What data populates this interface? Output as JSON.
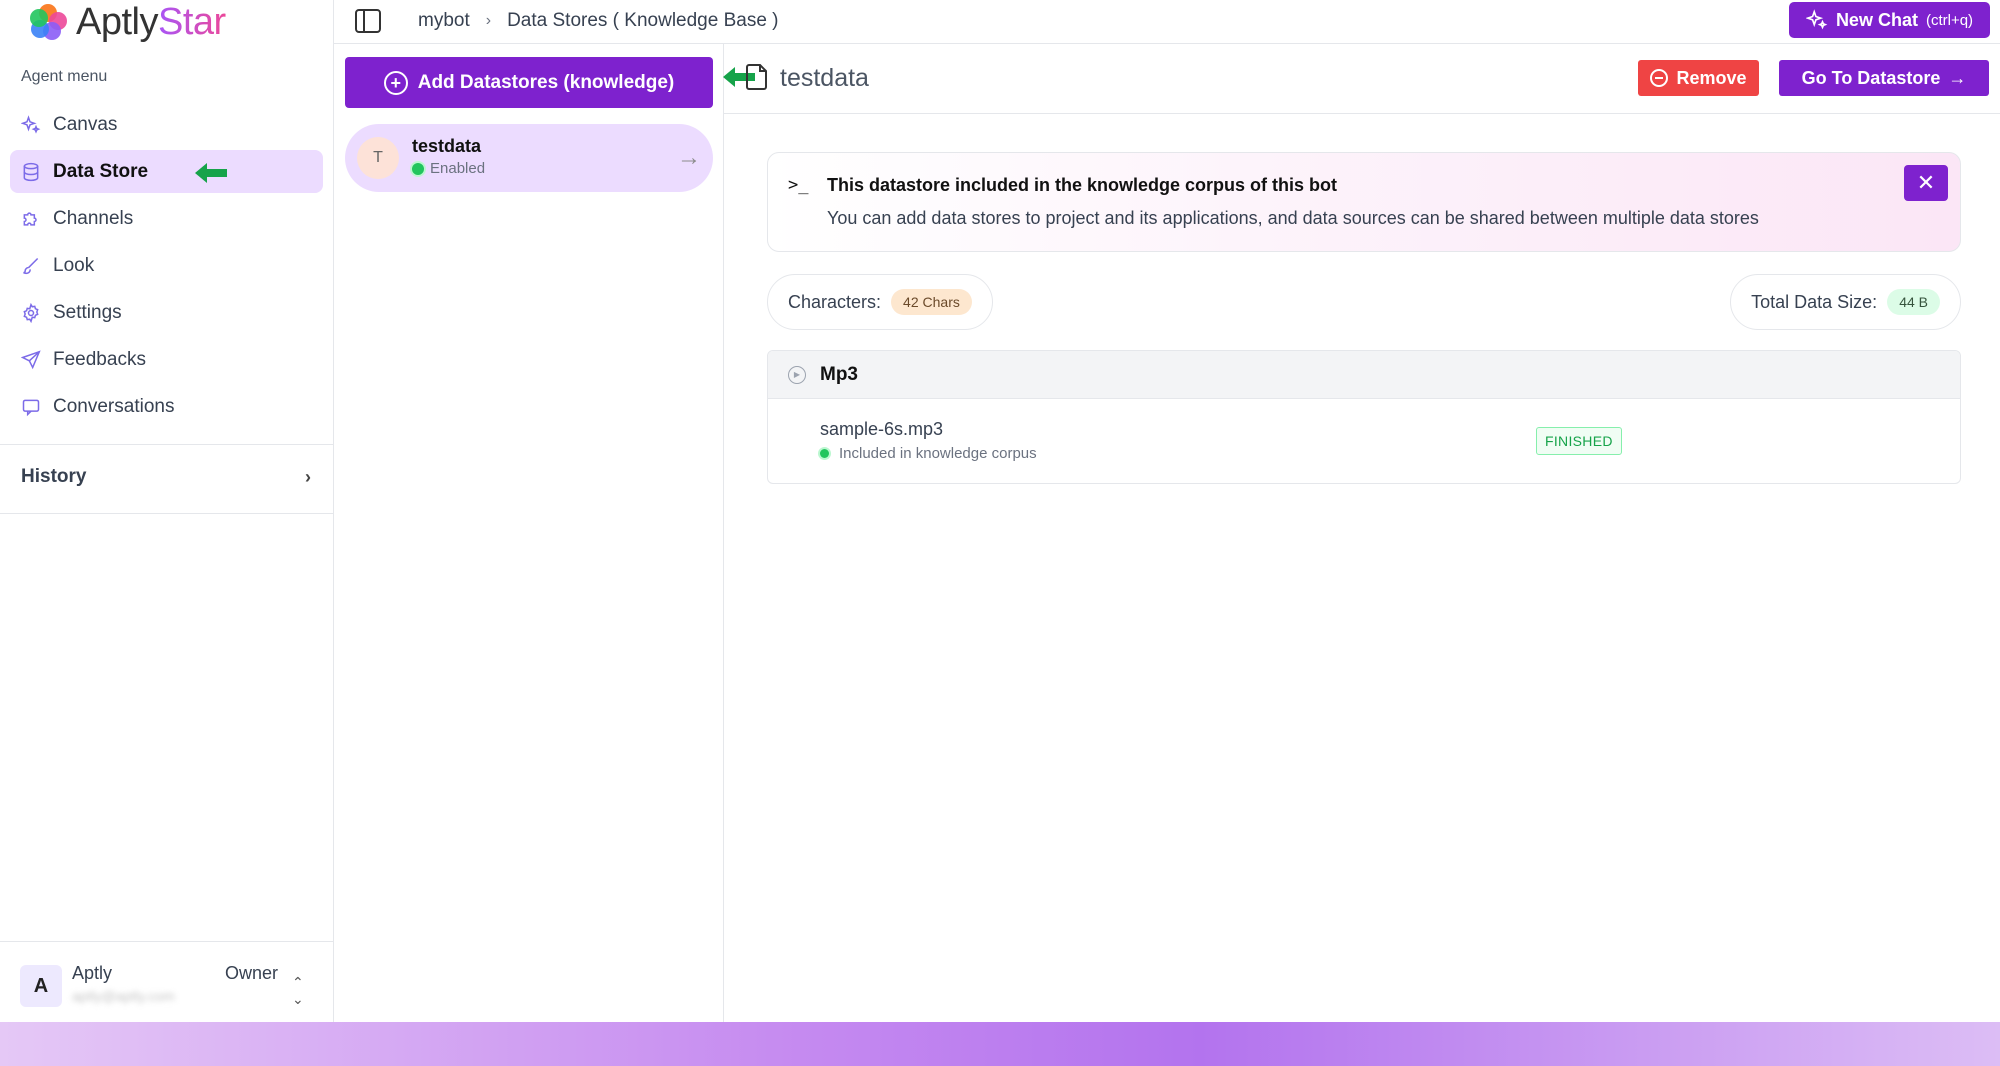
{
  "app": {
    "logo_text_main": "Aptly",
    "logo_text_accent": "Star"
  },
  "sidebar": {
    "section_label": "Agent menu",
    "items": [
      {
        "label": "Canvas",
        "icon": "sparkles-icon"
      },
      {
        "label": "Data Store",
        "icon": "database-icon",
        "active": true
      },
      {
        "label": "Channels",
        "icon": "puzzle-icon"
      },
      {
        "label": "Look",
        "icon": "brush-icon"
      },
      {
        "label": "Settings",
        "icon": "gear-icon"
      },
      {
        "label": "Feedbacks",
        "icon": "send-icon"
      },
      {
        "label": "Conversations",
        "icon": "chat-icon"
      }
    ],
    "history_label": "History",
    "user": {
      "initial": "A",
      "name": "Aptly",
      "email": "aptly@aptly.com",
      "role": "Owner"
    }
  },
  "topbar": {
    "breadcrumb": [
      "mybot",
      "Data Stores ( Knowledge Base )"
    ],
    "new_chat_label": "New Chat",
    "new_chat_shortcut": "(ctrl+q)"
  },
  "list": {
    "add_button_label": "Add Datastores (knowledge)",
    "items": [
      {
        "initial": "T",
        "name": "testdata",
        "status": "Enabled"
      }
    ]
  },
  "main": {
    "title": "testdata",
    "remove_label": "Remove",
    "goto_label": "Go To Datastore",
    "banner": {
      "title": "This datastore included in the knowledge corpus of this bot",
      "text": "You can add data stores to project and its applications, and data sources can be shared between multiple data stores"
    },
    "characters_label": "Characters:",
    "characters_value": "42 Chars",
    "size_label": "Total Data Size:",
    "size_value": "44 B",
    "group": {
      "name": "Mp3",
      "files": [
        {
          "name": "sample-6s.mp3",
          "sub": "Included in knowledge corpus",
          "status": "FINISHED"
        }
      ]
    }
  },
  "colors": {
    "accent": "#7e22ce",
    "danger": "#ef4444",
    "active_bg": "#ecdcff",
    "annotation_arrow": "#16a34a"
  }
}
